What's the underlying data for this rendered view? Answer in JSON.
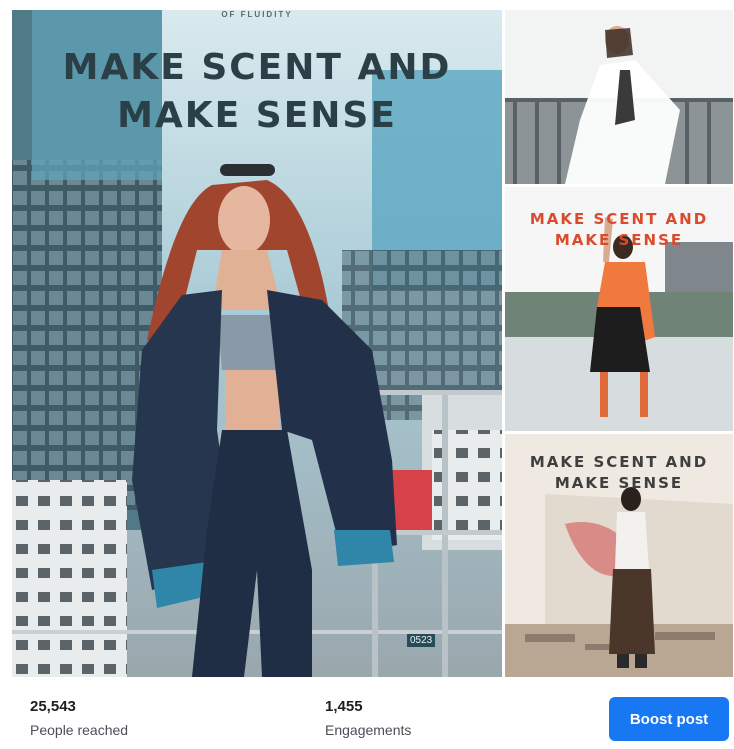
{
  "post": {
    "main_image": {
      "kicker": "OF FLUIDITY",
      "headline_line1": "MAKE SCENT AND",
      "headline_line2": "MAKE SENSE"
    },
    "mid_right_image": {
      "headline_line1": "MAKE SCENT AND",
      "headline_line2": "MAKE SENSE"
    },
    "bottom_right_image": {
      "headline_line1": "MAKE SCENT AND",
      "headline_line2": "MAKE SENSE"
    },
    "sign_text": "0523"
  },
  "insights": {
    "reached_value": "25,543",
    "reached_label": "People reached",
    "engagements_value": "1,455",
    "engagements_label": "Engagements"
  },
  "actions": {
    "boost_label": "Boost post"
  },
  "colors": {
    "boost_button": "#1877f2",
    "main_headline": "#2b3f46",
    "accent_headline": "#d94b2b"
  }
}
